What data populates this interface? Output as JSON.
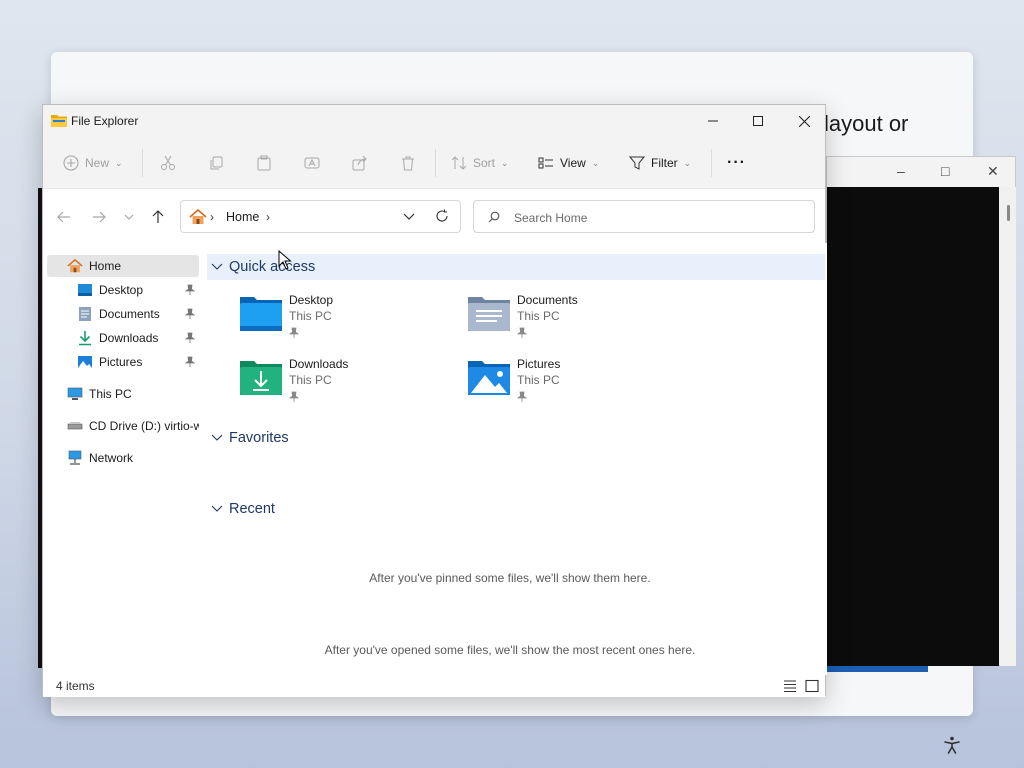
{
  "background": {
    "partial_text": "layout or"
  },
  "window": {
    "title": "File Explorer"
  },
  "toolbar": {
    "new_label": "New",
    "sort_label": "Sort",
    "view_label": "View",
    "filter_label": "Filter",
    "more_label": "···"
  },
  "address": {
    "location": "Home"
  },
  "search": {
    "placeholder": "Search Home"
  },
  "sidebar": {
    "items": [
      {
        "label": "Home"
      },
      {
        "label": "Desktop"
      },
      {
        "label": "Documents"
      },
      {
        "label": "Downloads"
      },
      {
        "label": "Pictures"
      },
      {
        "label": "This PC"
      },
      {
        "label": "CD Drive (D:) virtio-w"
      },
      {
        "label": "Network"
      }
    ]
  },
  "content": {
    "quick_access": {
      "heading": "Quick access",
      "tiles": [
        {
          "name": "Desktop",
          "location": "This PC"
        },
        {
          "name": "Documents",
          "location": "This PC"
        },
        {
          "name": "Downloads",
          "location": "This PC"
        },
        {
          "name": "Pictures",
          "location": "This PC"
        }
      ]
    },
    "favorites": {
      "heading": "Favorites",
      "empty_message": "After you've pinned some files, we'll show them here."
    },
    "recent": {
      "heading": "Recent",
      "empty_message": "After you've opened some files, we'll show the most recent ones here."
    }
  },
  "status": {
    "item_count": "4 items"
  },
  "colors": {
    "accent": "#1f3864",
    "selected_bg": "#e5e5e5",
    "highlight_bg": "#e8f1fb"
  }
}
